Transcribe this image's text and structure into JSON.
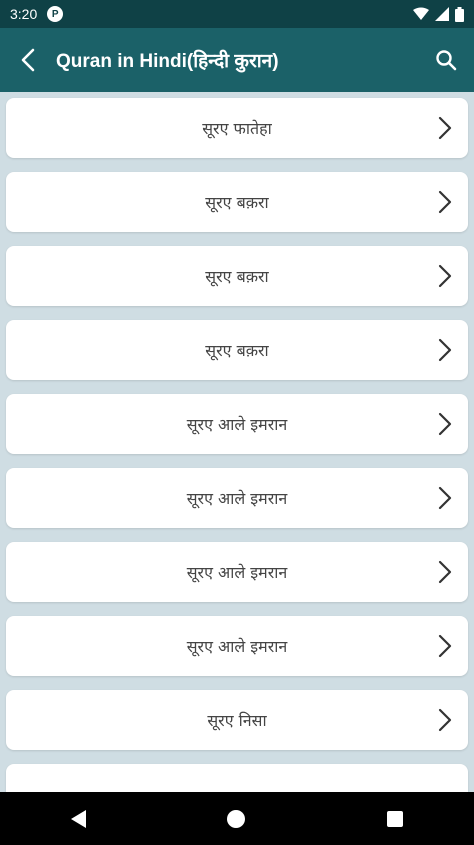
{
  "status_bar": {
    "time": "3:20",
    "badge": "P"
  },
  "app_bar": {
    "title": "Quran in Hindi(हिन्दी कुरान)"
  },
  "list": {
    "items": [
      {
        "label": "सूरए फातेहा"
      },
      {
        "label": "सूरए बक़रा"
      },
      {
        "label": "सूरए बक़रा"
      },
      {
        "label": "सूरए बक़रा"
      },
      {
        "label": "सूरए आले इमरान"
      },
      {
        "label": "सूरए आले इमरान"
      },
      {
        "label": "सूरए आले इमरान"
      },
      {
        "label": "सूरए आले इमरान"
      },
      {
        "label": "सूरए निसा"
      },
      {
        "label": ""
      }
    ]
  },
  "colors": {
    "app_bar": "#1b6168",
    "status_bar": "#0f4146",
    "background": "#cfdde3"
  },
  "icons": {
    "back": "back-arrow-icon",
    "search": "search-icon",
    "chevron": "chevron-right-icon"
  }
}
